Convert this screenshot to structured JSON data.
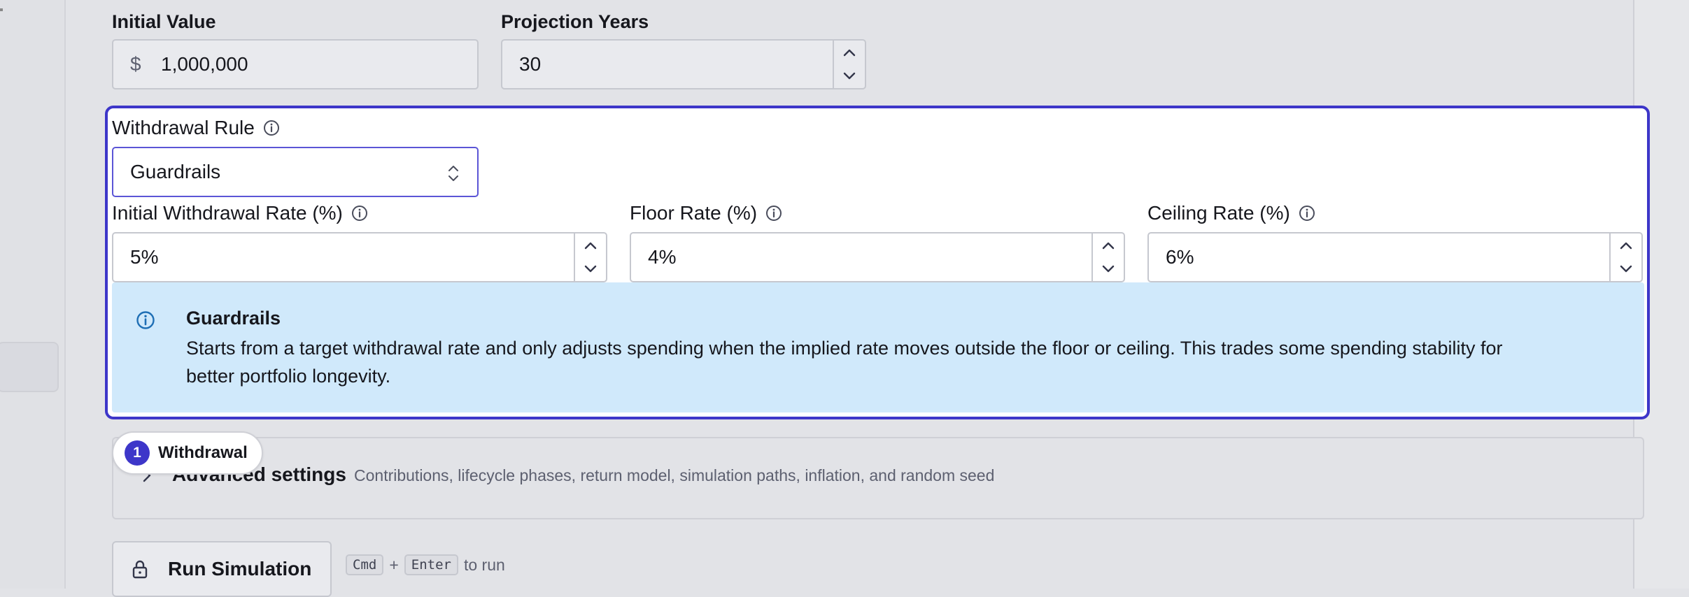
{
  "basics": {
    "initial_value_label": "Initial Value",
    "currency_symbol": "$",
    "initial_value": "1,000,000",
    "projection_years_label": "Projection Years",
    "projection_years": "30"
  },
  "withdrawal": {
    "rule_label": "Withdrawal Rule",
    "rule_value": "Guardrails",
    "initial_rate_label": "Initial Withdrawal Rate (%)",
    "initial_rate": "5%",
    "floor_rate_label": "Floor Rate (%)",
    "floor_rate": "4%",
    "ceiling_rate_label": "Ceiling Rate (%)",
    "ceiling_rate": "6%",
    "callout_title": "Guardrails",
    "callout_line1": "Starts from a target withdrawal rate and only adjusts spending when the implied rate moves outside the floor or ceiling. This trades some spending stability for",
    "callout_line2": "better portfolio longevity."
  },
  "tour_badge": {
    "number": "1",
    "label": "Withdrawal"
  },
  "advanced": {
    "title": "Advanced settings",
    "description": "Contributions, lifecycle phases, return model, simulation paths, inflation, and random seed"
  },
  "run": {
    "button_label": "Run Simulation",
    "kbd_cmd": "Cmd",
    "plus": "+",
    "kbd_enter": "Enter",
    "hint": "to run"
  },
  "colors": {
    "accent": "#3d36c9",
    "callout_bg": "#d0e9fb",
    "info_blue": "#1f6fb5"
  }
}
